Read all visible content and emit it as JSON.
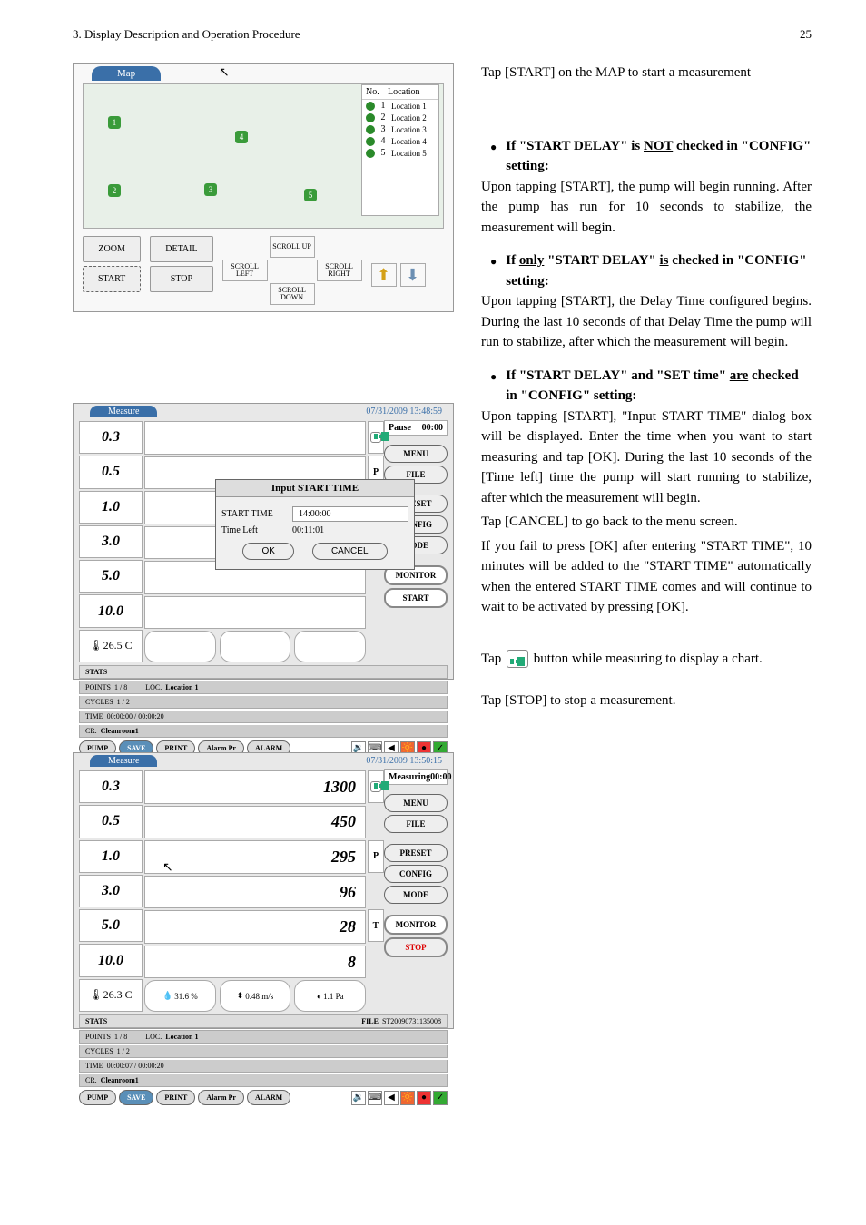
{
  "header": {
    "left": "3. Display Description and Operation Procedure",
    "right": "25"
  },
  "right_text": {
    "p1": "Tap [START] on the MAP to start a measurement",
    "b1_title_a": "If \"START DELAY\" is ",
    "b1_title_b": "NOT",
    "b1_title_c": " checked in \"CONFIG\" setting:",
    "b1_body": "Upon tapping [START], the pump will begin running. After the pump has run for 10 seconds to stabilize, the measurement will begin.",
    "b2_title_a": "If ",
    "b2_title_b": "only",
    "b2_title_c": " \"START DELAY\" ",
    "b2_title_d": "is",
    "b2_title_e": " checked in \"CONFIG\" setting:",
    "b2_body": "Upon tapping [START], the Delay Time configured begins. During the last 10 seconds of that Delay Time the pump will run to stabilize, after which the measurement will begin.",
    "b3_title_a": "If \"START DELAY\" and \"SET time\" ",
    "b3_title_b": "are",
    "b3_title_c": " checked in \"CONFIG\" setting:",
    "b3_body1": "Upon tapping [START], \"Input START TIME\" dialog box will be displayed. Enter the time when you want to start measuring and tap [OK]. During the last 10 seconds of the [Time left] time the pump will start running to stabilize, after which the measurement will begin.",
    "b3_body2": "Tap [CANCEL] to go back to the menu screen.",
    "b3_body3": "If you fail to press [OK] after entering \"START TIME\", 10 minutes will be added to the \"START TIME\" automatically when the entered START TIME comes and will continue to wait to be activated by pressing [OK].",
    "tap_chart_a": "Tap ",
    "tap_chart_b": " button while measuring to display a chart.",
    "stop": "Tap [STOP] to stop a measurement."
  },
  "map": {
    "tab": "Map",
    "legend_h1": "No.",
    "legend_h2": "Location",
    "locations": [
      {
        "no": "1",
        "name": "Location 1"
      },
      {
        "no": "2",
        "name": "Location 2"
      },
      {
        "no": "3",
        "name": "Location 3"
      },
      {
        "no": "4",
        "name": "Location 4"
      },
      {
        "no": "5",
        "name": "Location 5"
      }
    ],
    "zoom": "ZOOM",
    "detail": "DETAIL",
    "start": "START",
    "stop": "STOP",
    "scroll_up": "SCROLL UP",
    "scroll_left": "SCROLL LEFT",
    "scroll_right": "SCROLL RIGHT",
    "scroll_down": "SCROLL DOWN"
  },
  "measure": {
    "tab": "Measure",
    "sizes": [
      "0.3",
      "0.5",
      "1.0",
      "3.0",
      "5.0",
      "10.0"
    ],
    "temp1": "26.5 C",
    "temp2": "26.3 C",
    "humidity": "31.6 %",
    "airflow": "0.48 m/s",
    "pressure": "1.1 Pa",
    "timestamp1": "07/31/2009 13:48:59",
    "timestamp2": "07/31/2009 13:50:15",
    "pause": "Pause",
    "measuring": "Measuring",
    "pause_time": "00:00",
    "menu": "MENU",
    "file": "FILE",
    "preset": "PRESET",
    "config": "CONFIG",
    "mode": "MODE",
    "monitor": "MONITOR",
    "start": "START",
    "stop": "STOP",
    "pump": "PUMP",
    "save": "SAVE",
    "print": "PRINT",
    "alarmpr": "Alarm Pr",
    "alarm": "ALARM",
    "stats": "STATS",
    "file_label": "FILE",
    "file_id": "ST20090731135008",
    "points_label": "POINTS",
    "points": "1 / 8",
    "cycles_label": "CYCLES",
    "cycles": "1 / 2",
    "time_label": "TIME",
    "time": "00:00:07 / 00:00:20",
    "time_alt": "00:00:00 / 00:00:20",
    "cr_label": "CR.",
    "cr": "Cleanroom1",
    "loc_label": "LOC.",
    "loc": "Location 1",
    "counts": [
      "1300",
      "450",
      "295",
      "96",
      "28",
      "8"
    ],
    "ind_p": "P",
    "ind_t": "T"
  },
  "dialog": {
    "title": "Input START TIME",
    "start_time_label": "START TIME",
    "start_time": "14:00:00",
    "time_left_label": "Time Left",
    "time_left": "00:11:01",
    "ok": "OK",
    "cancel": "CANCEL"
  }
}
